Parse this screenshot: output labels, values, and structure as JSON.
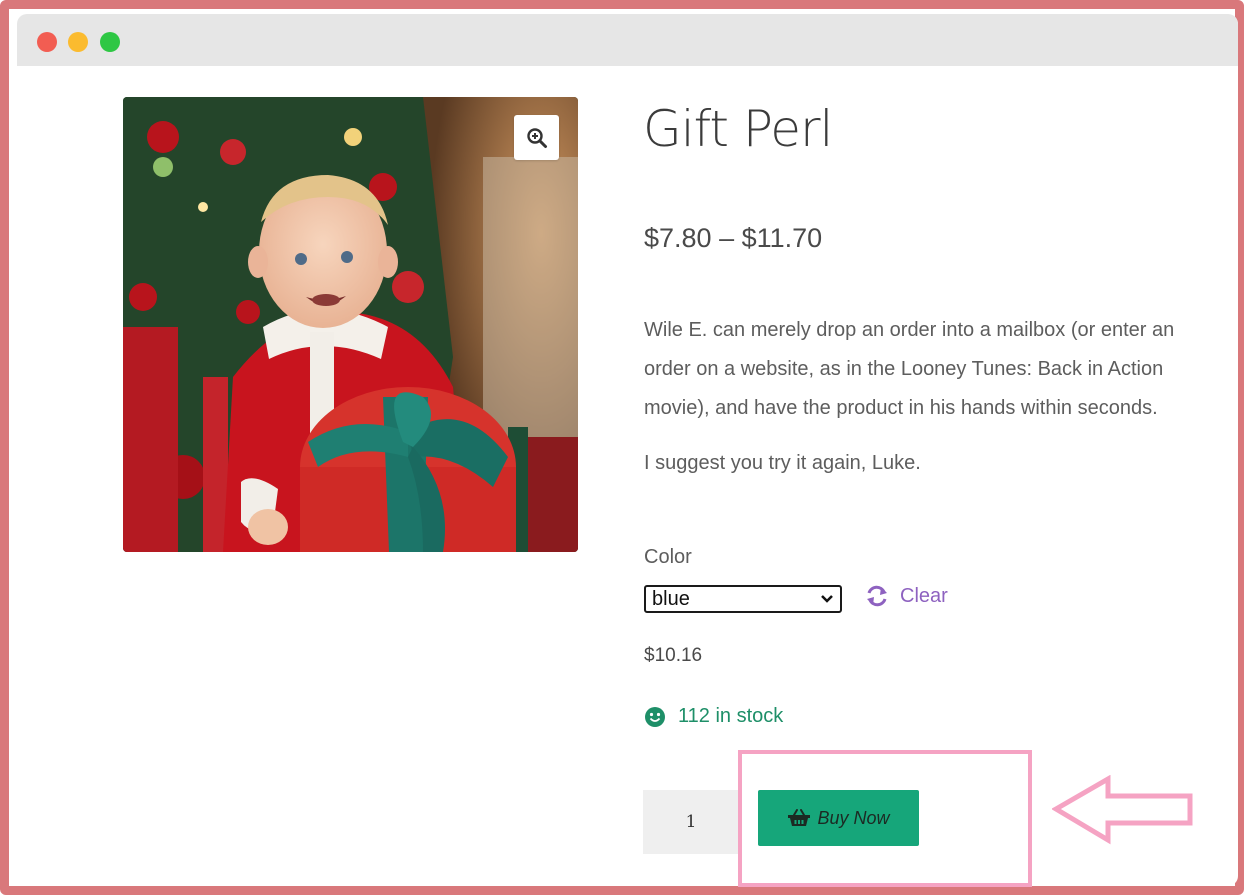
{
  "product": {
    "title": "Gift Perl",
    "price_range": "$7.80 – $11.70",
    "description": "Wile E. can merely drop an order into a mailbox (or enter an order on a website, as in the Looney Tunes: Back in Action movie), and have the product in his hands within seconds.",
    "description_2": "I suggest you try it again, Luke.",
    "image_icon": "zoom-in-icon"
  },
  "variations": {
    "color_label": "Color",
    "color_selected": "blue",
    "clear_label": "Clear",
    "clear_icon": "refresh-icon"
  },
  "variation_price": "$10.16",
  "stock": {
    "text": "112 in stock",
    "icon": "smiley-icon"
  },
  "cart": {
    "quantity": "1",
    "buy_label": "Buy Now",
    "buy_icon": "basket-icon"
  },
  "colors": {
    "frame": "#d9787b",
    "accent_button": "#16a67a",
    "link": "#8e62c0",
    "stock": "#1e8f68",
    "highlight": "#f5a3c3"
  }
}
